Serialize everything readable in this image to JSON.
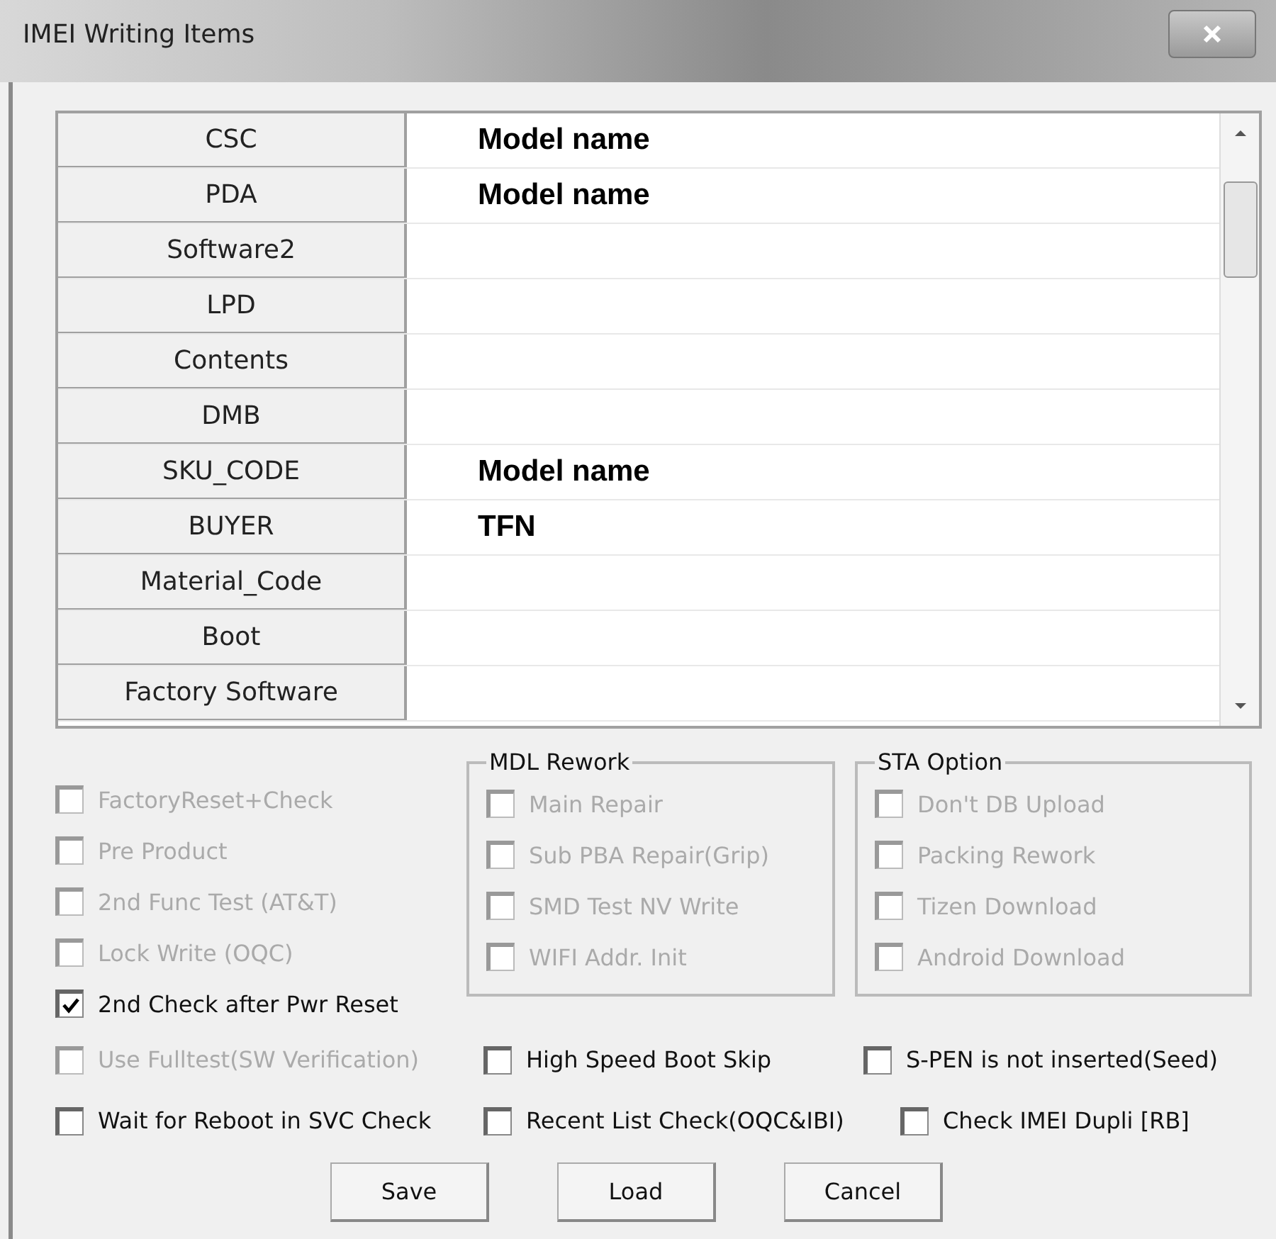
{
  "window": {
    "title": "IMEI Writing Items"
  },
  "grid": {
    "rows": [
      {
        "label": "CSC",
        "value": "Model name"
      },
      {
        "label": "PDA",
        "value": "Model name"
      },
      {
        "label": "Software2"
      },
      {
        "label": "LPD"
      },
      {
        "label": "Contents"
      },
      {
        "label": "DMB"
      },
      {
        "label": "SKU_CODE",
        "value": "Model name"
      },
      {
        "label": "BUYER",
        "value": "TFN"
      },
      {
        "label": "Material_Code"
      },
      {
        "label": "Boot"
      },
      {
        "label": "Factory Software"
      }
    ]
  },
  "left_options": [
    {
      "label": "FactoryReset+Check",
      "checked": false,
      "disabled": true
    },
    {
      "label": "Pre Product",
      "checked": false,
      "disabled": true
    },
    {
      "label": "2nd Func Test (AT&T)",
      "checked": false,
      "disabled": true
    },
    {
      "label": "Lock Write (OQC)",
      "checked": false,
      "disabled": true
    },
    {
      "label": "2nd Check after Pwr Reset",
      "checked": true,
      "disabled": false
    }
  ],
  "groups": [
    {
      "title": "MDL Rework",
      "items": [
        {
          "label": "Main Repair",
          "checked": false,
          "disabled": true
        },
        {
          "label": "Sub PBA Repair(Grip)",
          "checked": false,
          "disabled": true
        },
        {
          "label": "SMD Test NV Write",
          "checked": false,
          "disabled": true
        },
        {
          "label": "WIFI Addr. Init",
          "checked": false,
          "disabled": true
        }
      ]
    },
    {
      "title": "STA Option",
      "items": [
        {
          "label": "Don't DB Upload",
          "checked": false,
          "disabled": true
        },
        {
          "label": "Packing Rework",
          "checked": false,
          "disabled": true
        },
        {
          "label": "Tizen Download",
          "checked": false,
          "disabled": true
        },
        {
          "label": "Android Download",
          "checked": false,
          "disabled": true
        }
      ]
    }
  ],
  "bottom_rows": [
    [
      {
        "label": "Use Fulltest(SW Verification)",
        "checked": false,
        "disabled": true
      },
      {
        "label": "High Speed Boot Skip",
        "checked": false,
        "disabled": false
      },
      {
        "label": "S-PEN is not inserted(Seed)",
        "checked": false,
        "disabled": false
      }
    ],
    [
      {
        "label": "Wait for Reboot in SVC Check",
        "checked": false,
        "disabled": false
      },
      {
        "label": "Recent List Check(OQC&IBI)",
        "checked": false,
        "disabled": false
      },
      {
        "label": "Check IMEI Dupli [RB]",
        "checked": false,
        "disabled": false
      }
    ]
  ],
  "buttons": [
    "Save",
    "Load",
    "Cancel"
  ]
}
